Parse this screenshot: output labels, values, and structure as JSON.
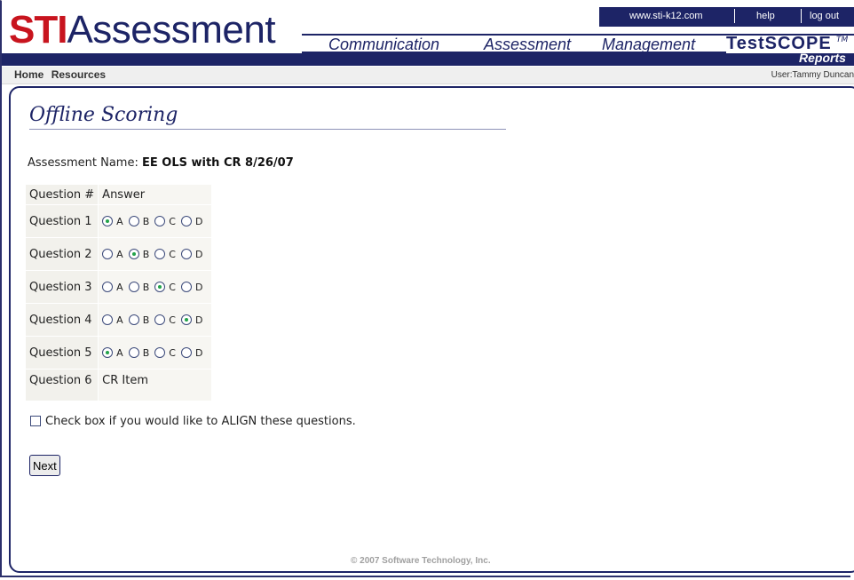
{
  "header": {
    "logo_red": "STI",
    "logo_blue": "Assessment",
    "top_links": [
      "www.sti-k12.com",
      "help",
      "log out"
    ],
    "nav": [
      "Communication",
      "Assessment",
      "Management"
    ],
    "testscope": "TestSCOPE",
    "tm": "TM",
    "reports": "Reports"
  },
  "subbar": {
    "links": [
      "Home",
      "Resources"
    ],
    "user": "User:Tammy Duncan"
  },
  "page": {
    "title": "Offline Scoring",
    "assessment_label": "Assessment Name: ",
    "assessment_value": "EE OLS with CR 8/26/07"
  },
  "table": {
    "headers": [
      "Question #",
      "Answer"
    ],
    "options": [
      "A",
      "B",
      "C",
      "D"
    ],
    "rows": [
      {
        "label": "Question 1",
        "selected": "A"
      },
      {
        "label": "Question 2",
        "selected": "B"
      },
      {
        "label": "Question 3",
        "selected": "C"
      },
      {
        "label": "Question 4",
        "selected": "D"
      },
      {
        "label": "Question 5",
        "selected": "A"
      },
      {
        "label": "Question 6",
        "text": "CR Item"
      }
    ]
  },
  "align_label": "Check box if you would like to ALIGN these questions.",
  "next_label": "Next",
  "footer": "© 2007 Software Technology, Inc.",
  "colors": {
    "brand_blue": "#1d2466",
    "brand_red": "#c8141e",
    "radio_selected": "#23a34a"
  }
}
